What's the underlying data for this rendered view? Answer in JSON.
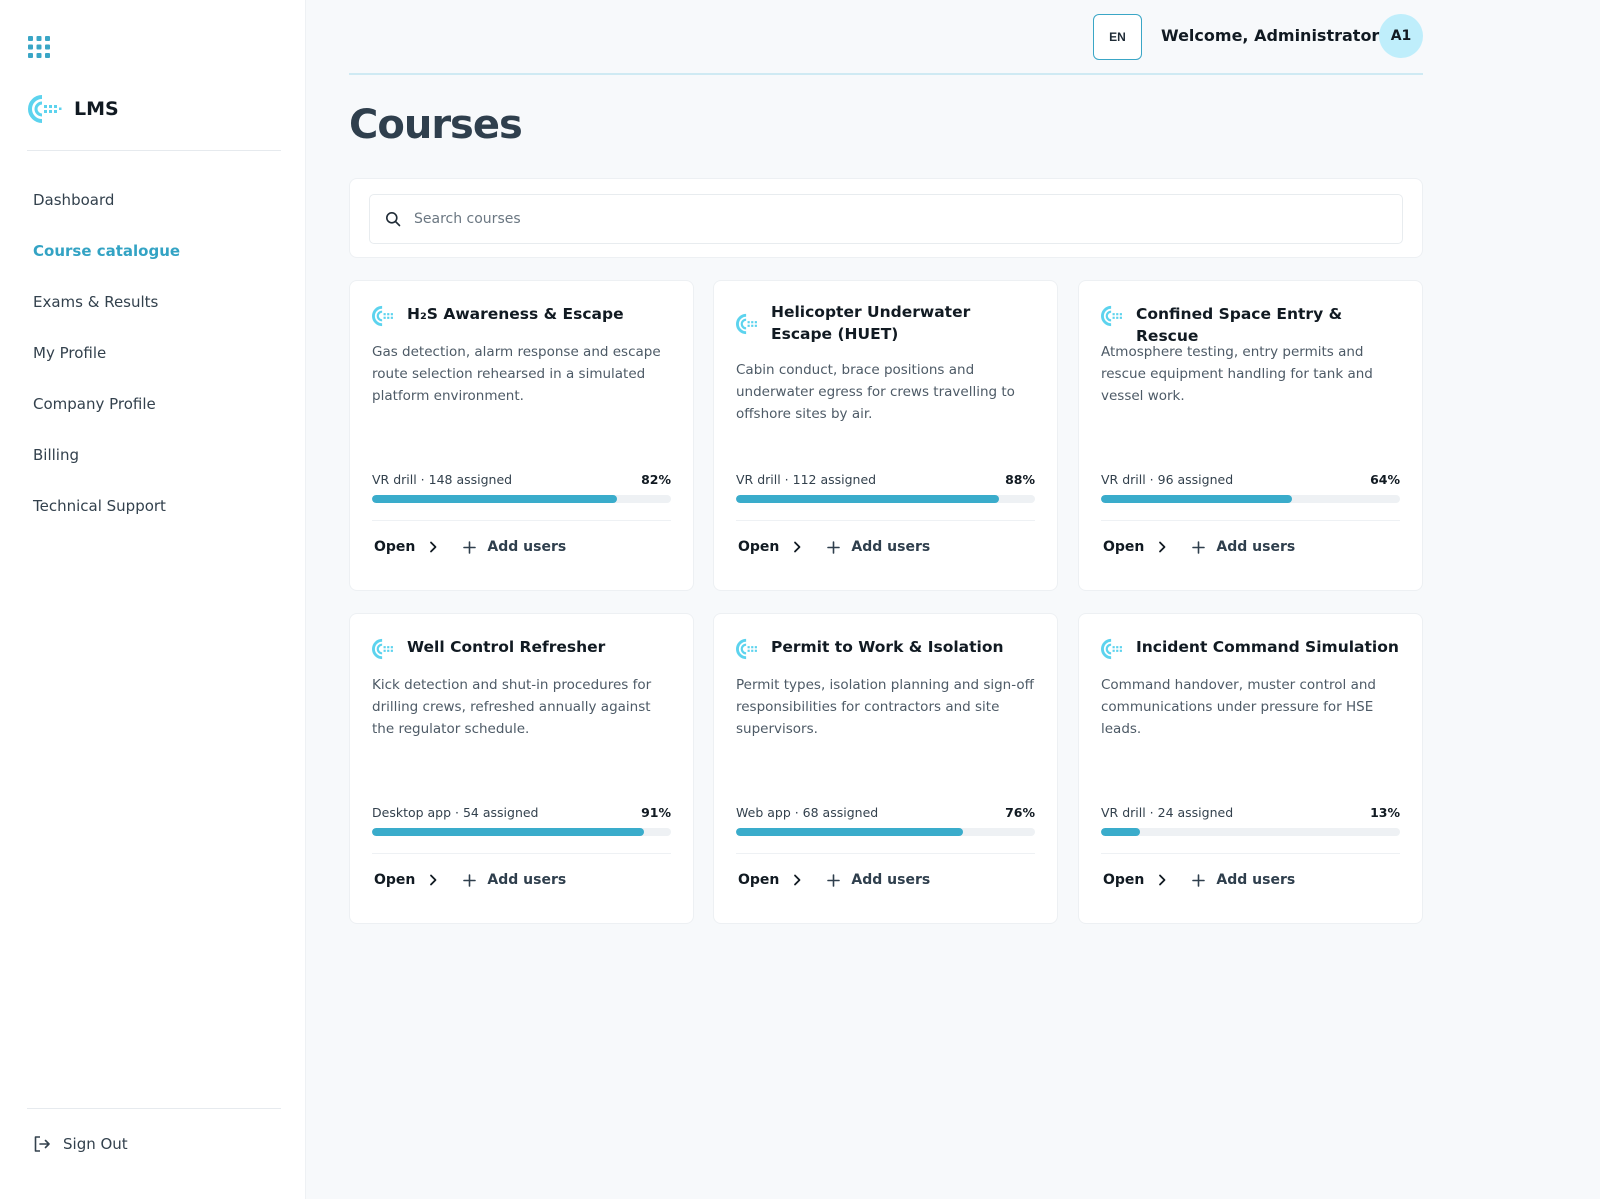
{
  "app": {
    "name": "LMS"
  },
  "sidebar": {
    "items": [
      {
        "label": "Dashboard",
        "active": false
      },
      {
        "label": "Course catalogue",
        "active": true
      },
      {
        "label": "Exams & Results",
        "active": false
      },
      {
        "label": "My Profile",
        "active": false
      },
      {
        "label": "Company Profile",
        "active": false
      },
      {
        "label": "Billing",
        "active": false
      },
      {
        "label": "Technical Support",
        "active": false
      }
    ],
    "sign_out": "Sign Out"
  },
  "header": {
    "language": "EN",
    "welcome": "Welcome, Administrator 1",
    "avatar_initials": "A1"
  },
  "page": {
    "title": "Courses"
  },
  "search": {
    "placeholder": "Search courses"
  },
  "colors": {
    "accent": "#33a3c4",
    "progress": "#3aaccb",
    "avatar_bg": "#bfeefb"
  },
  "courses": [
    {
      "title": "H₂S Awareness & Escape",
      "description": "Gas detection, alarm response and escape route selection rehearsed in a simulated platform environment.",
      "meta": "VR drill · 148 assigned",
      "progress_label": "82%",
      "progress": 82,
      "open_label": "Open",
      "add_label": "Add users"
    },
    {
      "title": "Helicopter Underwater Escape (HUET)",
      "description": "Cabin conduct, brace positions and underwater egress for crews travelling to offshore sites by air.",
      "meta": "VR drill · 112 assigned",
      "progress_label": "88%",
      "progress": 88,
      "open_label": "Open",
      "add_label": "Add users"
    },
    {
      "title": "Confined Space Entry & Rescue",
      "description": "Atmosphere testing, entry permits and rescue equipment handling for tank and vessel work.",
      "meta": "VR drill · 96 assigned",
      "progress_label": "64%",
      "progress": 64,
      "open_label": "Open",
      "add_label": "Add users"
    },
    {
      "title": "Well Control Refresher",
      "description": "Kick detection and shut-in procedures for drilling crews, refreshed annually against the regulator schedule.",
      "meta": "Desktop app · 54 assigned",
      "progress_label": "91%",
      "progress": 91,
      "open_label": "Open",
      "add_label": "Add users"
    },
    {
      "title": "Permit to Work & Isolation",
      "description": "Permit types, isolation planning and sign-off responsibilities for contractors and site supervisors.",
      "meta": "Web app · 68 assigned",
      "progress_label": "76%",
      "progress": 76,
      "open_label": "Open",
      "add_label": "Add users"
    },
    {
      "title": "Incident Command Simulation",
      "description": "Command handover, muster control and communications under pressure for HSE leads.",
      "meta": "VR drill · 24 assigned",
      "progress_label": "13%",
      "progress": 13,
      "open_label": "Open",
      "add_label": "Add users"
    }
  ]
}
